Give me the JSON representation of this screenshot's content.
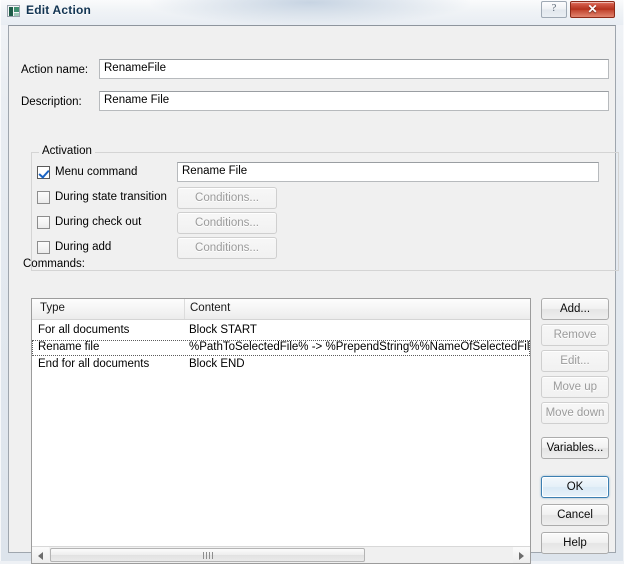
{
  "window": {
    "title": "Edit Action",
    "icon": "app-icon",
    "help_button": "?",
    "close_button": "✕"
  },
  "form": {
    "action_name_label": "Action name:",
    "action_name_value": "RenameFile",
    "description_label": "Description:",
    "description_value": "Rename File"
  },
  "activation": {
    "group_title": "Activation",
    "rows": [
      {
        "label": "Menu command",
        "checked": true,
        "control": "textbox",
        "value": "Rename File"
      },
      {
        "label": "During state transition",
        "checked": false,
        "control": "button",
        "value": "Conditions...",
        "disabled": true
      },
      {
        "label": "During check out",
        "checked": false,
        "control": "button",
        "value": "Conditions...",
        "disabled": true
      },
      {
        "label": "During add",
        "checked": false,
        "control": "button",
        "value": "Conditions...",
        "disabled": true
      }
    ]
  },
  "commands": {
    "label": "Commands:",
    "columns": [
      "Type",
      "Content"
    ],
    "rows": [
      {
        "type": "For all documents",
        "content": "Block START",
        "selected": false
      },
      {
        "type": "Rename file",
        "content": "%PathToSelectedFile% -> %PrependString%%NameOfSelectedFile%",
        "selected": true
      },
      {
        "type": "End for all documents",
        "content": "Block END",
        "selected": false
      }
    ],
    "scrollbar": {
      "left_arrow": "◄",
      "right_arrow": "►"
    }
  },
  "side_buttons": [
    {
      "label": "Add...",
      "disabled": false
    },
    {
      "label": "Remove",
      "disabled": true
    },
    {
      "label": "Edit...",
      "disabled": true
    },
    {
      "label": "Move up",
      "disabled": true
    },
    {
      "label": "Move down",
      "disabled": true
    },
    {
      "label": "Variables...",
      "disabled": false
    }
  ],
  "dialog_buttons": [
    {
      "label": "OK",
      "default": true
    },
    {
      "label": "Cancel",
      "default": false
    },
    {
      "label": "Help",
      "default": false
    }
  ],
  "colors": {
    "accent": "#3c7fb1",
    "close_red": "#b3301c",
    "check_blue": "#1a64c4",
    "panel": "#f0f0f0"
  }
}
